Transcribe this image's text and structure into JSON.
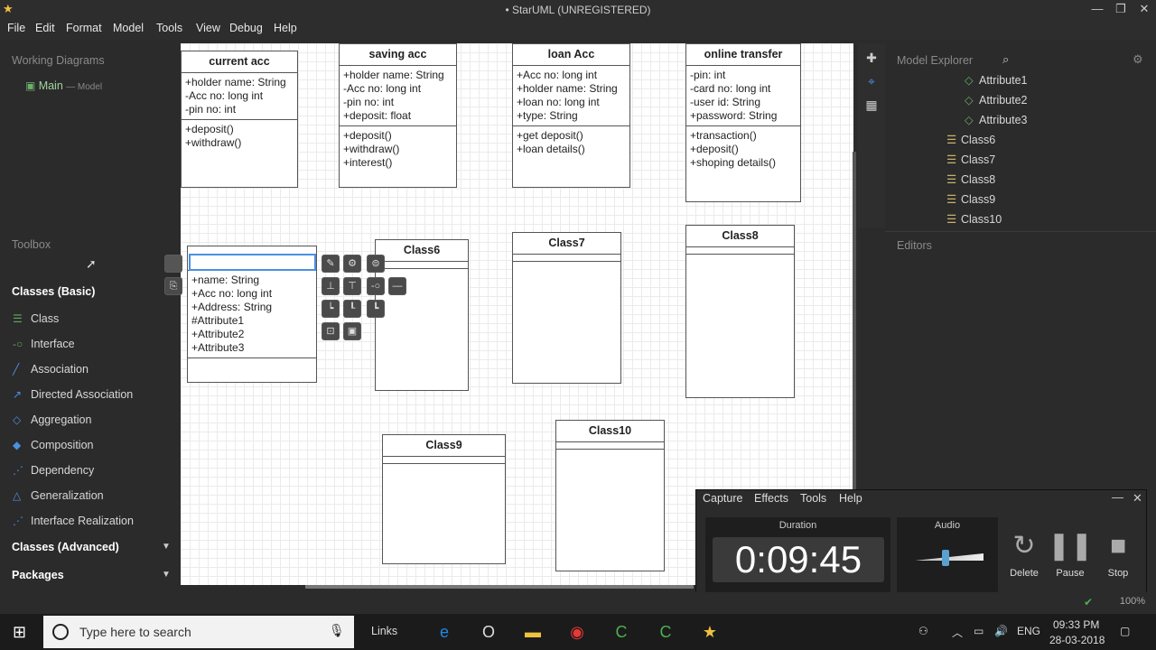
{
  "window": {
    "title": "• StarUML (UNREGISTERED)",
    "logo": "★",
    "minimize": "—",
    "maximize": "❐",
    "close": "✕"
  },
  "menu": [
    "File",
    "Edit",
    "Format",
    "Model",
    "Tools",
    "View",
    "Debug",
    "Help"
  ],
  "working_diagrams": {
    "title": "Working Diagrams",
    "item": "Main",
    "item_sub": "— Model"
  },
  "toolbox": {
    "title": "Toolbox",
    "section_basic": "Classes (Basic)",
    "items": [
      "Class",
      "Interface",
      "Association",
      "Directed Association",
      "Aggregation",
      "Composition",
      "Dependency",
      "Generalization",
      "Interface Realization"
    ],
    "section_advanced": "Classes (Advanced)",
    "section_packages": "Packages",
    "collapse_arrow": "▼"
  },
  "classes": {
    "current_acc": {
      "name": "current acc",
      "attrs": [
        "+holder name: String",
        "-Acc no: long int",
        "-pin no: int"
      ],
      "ops": [
        "+deposit()",
        "+withdraw()"
      ]
    },
    "saving_acc": {
      "name": "saving acc",
      "attrs": [
        "+holder name: String",
        "-Acc no: long int",
        "-pin no: int",
        "+deposit: float"
      ],
      "ops": [
        "+deposit()",
        "+withdraw()",
        "+interest()"
      ]
    },
    "loan_acc": {
      "name": "loan Acc",
      "attrs": [
        "+Acc no: long int",
        "+holder name: String",
        "+loan no: long int",
        "+type: String"
      ],
      "ops": [
        "+get deposit()",
        "+loan details()"
      ]
    },
    "online_transfer": {
      "name": "online transfer",
      "attrs": [
        "-pin: int",
        "-card no: long int",
        "-user id: String",
        "+password: String"
      ],
      "ops": [
        "+transaction()",
        "+deposit()",
        "+shoping details()"
      ]
    },
    "editing": {
      "attrs": [
        "+name: String",
        "+Acc no: long int",
        "+Address: String",
        "#Attribute1",
        "+Attribute2",
        "+Attribute3"
      ]
    },
    "class6": {
      "name": "Class6"
    },
    "class7": {
      "name": "Class7"
    },
    "class8": {
      "name": "Class8"
    },
    "class9": {
      "name": "Class9"
    },
    "class10": {
      "name": "Class10"
    }
  },
  "model_explorer": {
    "title": "Model Explorer",
    "items": [
      "Attribute1",
      "Attribute2",
      "Attribute3",
      "Class6",
      "Class7",
      "Class8",
      "Class9",
      "Class10"
    ]
  },
  "editors": {
    "title": "Editors"
  },
  "recorder": {
    "menu": [
      "Capture",
      "Effects",
      "Tools",
      "Help"
    ],
    "duration_label": "Duration",
    "duration": "0:09:45",
    "audio_label": "Audio",
    "audio_level": 0.45,
    "buttons": [
      "Delete",
      "Pause",
      "Stop"
    ]
  },
  "status": {
    "zoom": "100%"
  },
  "taskbar": {
    "search_placeholder": "Type here to search",
    "links": "Links",
    "language": "ENG",
    "time": "09:33 PM",
    "date": "28-03-2018"
  }
}
